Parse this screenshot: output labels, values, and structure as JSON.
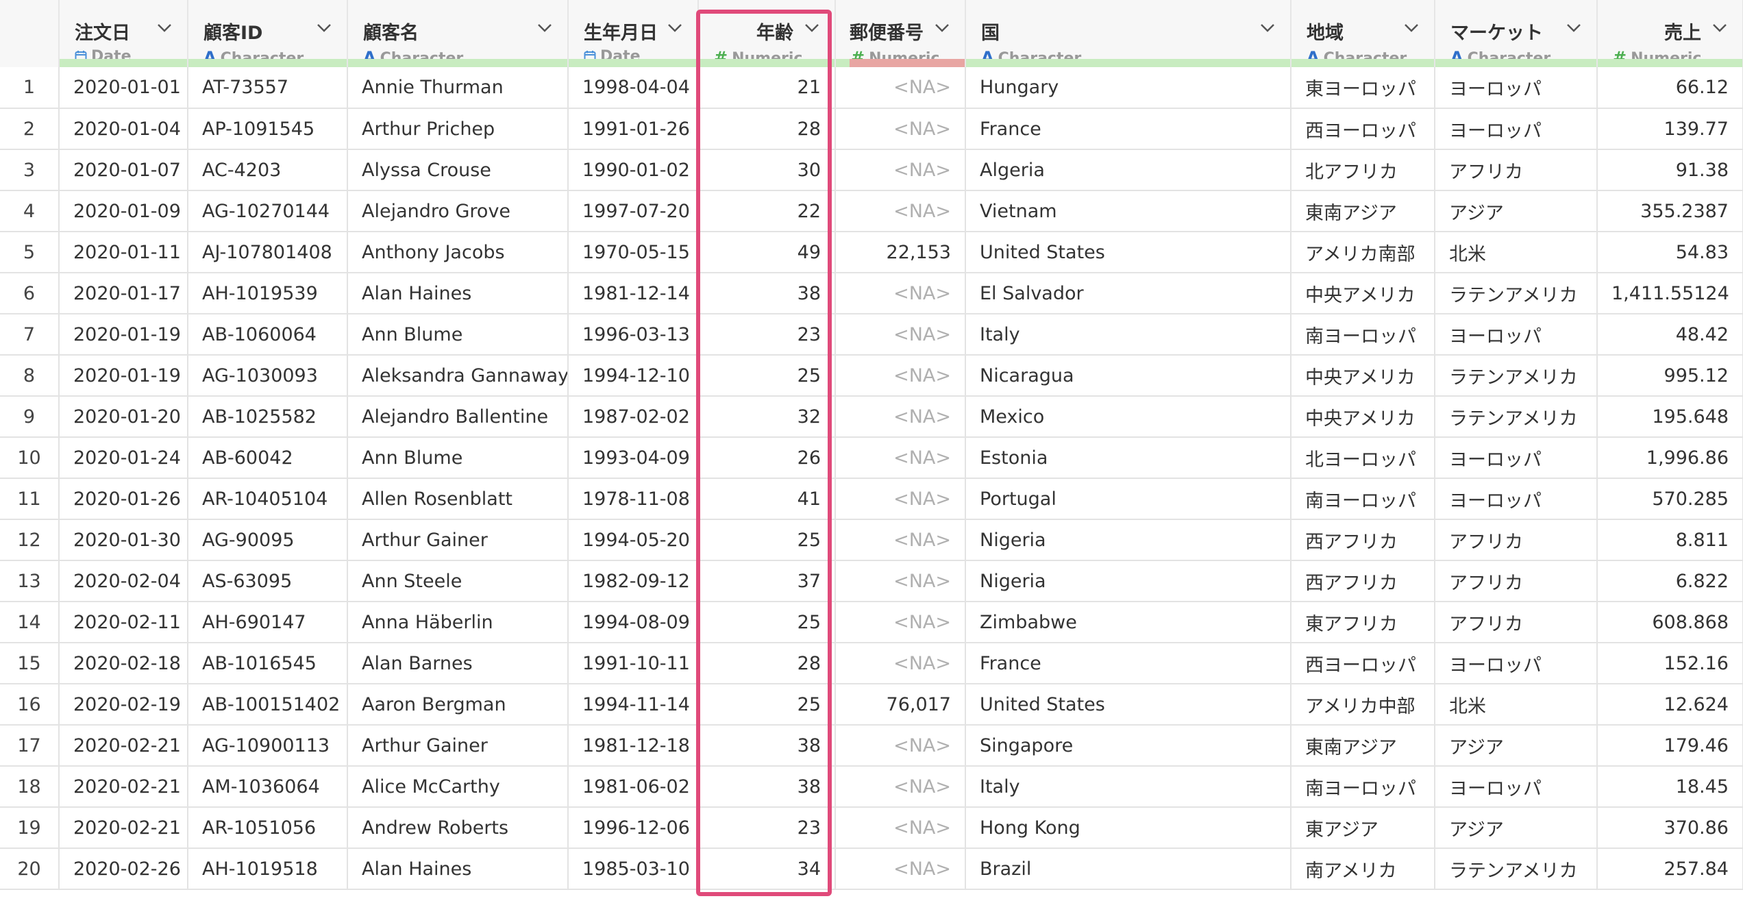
{
  "columns": [
    {
      "name": "注文日",
      "type": "Date",
      "icon": "calendar-icon",
      "align": "left",
      "bar": "green"
    },
    {
      "name": "顧客ID",
      "type": "Character",
      "icon": "character-icon",
      "align": "left",
      "bar": "green"
    },
    {
      "name": "顧客名",
      "type": "Character",
      "icon": "character-icon",
      "align": "left",
      "bar": "green"
    },
    {
      "name": "生年月日",
      "type": "Date",
      "icon": "calendar-icon",
      "align": "left",
      "bar": "green"
    },
    {
      "name": "年齢",
      "type": "Numeric",
      "icon": "hash-icon",
      "align": "right",
      "bar": "green"
    },
    {
      "name": "郵便番号",
      "type": "Numeric",
      "icon": "hash-icon",
      "align": "right",
      "bar": "mixed"
    },
    {
      "name": "国",
      "type": "Character",
      "icon": "character-icon",
      "align": "left",
      "bar": "green"
    },
    {
      "name": "地域",
      "type": "Character",
      "icon": "character-icon",
      "align": "left",
      "bar": "green"
    },
    {
      "name": "マーケット",
      "type": "Character",
      "icon": "character-icon",
      "align": "left",
      "bar": "green"
    },
    {
      "name": "売上",
      "type": "Numeric",
      "icon": "hash-icon",
      "align": "right",
      "bar": "green"
    }
  ],
  "highlighted_column": "年齢",
  "na_text": "<NA>",
  "colors": {
    "highlight": "#e04a7a",
    "bar_green": "#c8ecc0",
    "bar_red": "#e8a5a2",
    "date_icon": "#4a90d9",
    "char_icon": "#2f6fca",
    "num_icon": "#4caf50"
  },
  "rows": [
    [
      "1",
      "2020-01-01",
      "AT-73557",
      "Annie Thurman",
      "1998-04-04",
      "21",
      "<NA>",
      "Hungary",
      "東ヨーロッパ",
      "ヨーロッパ",
      "66.12"
    ],
    [
      "2",
      "2020-01-04",
      "AP-1091545",
      "Arthur Prichep",
      "1991-01-26",
      "28",
      "<NA>",
      "France",
      "西ヨーロッパ",
      "ヨーロッパ",
      "139.77"
    ],
    [
      "3",
      "2020-01-07",
      "AC-4203",
      "Alyssa Crouse",
      "1990-01-02",
      "30",
      "<NA>",
      "Algeria",
      "北アフリカ",
      "アフリカ",
      "91.38"
    ],
    [
      "4",
      "2020-01-09",
      "AG-10270144",
      "Alejandro Grove",
      "1997-07-20",
      "22",
      "<NA>",
      "Vietnam",
      "東南アジア",
      "アジア",
      "355.2387"
    ],
    [
      "5",
      "2020-01-11",
      "AJ-107801408",
      "Anthony Jacobs",
      "1970-05-15",
      "49",
      "22,153",
      "United States",
      "アメリカ南部",
      "北米",
      "54.83"
    ],
    [
      "6",
      "2020-01-17",
      "AH-1019539",
      "Alan Haines",
      "1981-12-14",
      "38",
      "<NA>",
      "El Salvador",
      "中央アメリカ",
      "ラテンアメリカ",
      "1,411.55124"
    ],
    [
      "7",
      "2020-01-19",
      "AB-1060064",
      "Ann Blume",
      "1996-03-13",
      "23",
      "<NA>",
      "Italy",
      "南ヨーロッパ",
      "ヨーロッパ",
      "48.42"
    ],
    [
      "8",
      "2020-01-19",
      "AG-1030093",
      "Aleksandra Gannaway",
      "1994-12-10",
      "25",
      "<NA>",
      "Nicaragua",
      "中央アメリカ",
      "ラテンアメリカ",
      "995.12"
    ],
    [
      "9",
      "2020-01-20",
      "AB-1025582",
      "Alejandro Ballentine",
      "1987-02-02",
      "32",
      "<NA>",
      "Mexico",
      "中央アメリカ",
      "ラテンアメリカ",
      "195.648"
    ],
    [
      "10",
      "2020-01-24",
      "AB-60042",
      "Ann Blume",
      "1993-04-09",
      "26",
      "<NA>",
      "Estonia",
      "北ヨーロッパ",
      "ヨーロッパ",
      "1,996.86"
    ],
    [
      "11",
      "2020-01-26",
      "AR-10405104",
      "Allen Rosenblatt",
      "1978-11-08",
      "41",
      "<NA>",
      "Portugal",
      "南ヨーロッパ",
      "ヨーロッパ",
      "570.285"
    ],
    [
      "12",
      "2020-01-30",
      "AG-90095",
      "Arthur Gainer",
      "1994-05-20",
      "25",
      "<NA>",
      "Nigeria",
      "西アフリカ",
      "アフリカ",
      "8.811"
    ],
    [
      "13",
      "2020-02-04",
      "AS-63095",
      "Ann Steele",
      "1982-09-12",
      "37",
      "<NA>",
      "Nigeria",
      "西アフリカ",
      "アフリカ",
      "6.822"
    ],
    [
      "14",
      "2020-02-11",
      "AH-690147",
      "Anna Häberlin",
      "1994-08-09",
      "25",
      "<NA>",
      "Zimbabwe",
      "東アフリカ",
      "アフリカ",
      "608.868"
    ],
    [
      "15",
      "2020-02-18",
      "AB-1016545",
      "Alan Barnes",
      "1991-10-11",
      "28",
      "<NA>",
      "France",
      "西ヨーロッパ",
      "ヨーロッパ",
      "152.16"
    ],
    [
      "16",
      "2020-02-19",
      "AB-100151402",
      "Aaron Bergman",
      "1994-11-14",
      "25",
      "76,017",
      "United States",
      "アメリカ中部",
      "北米",
      "12.624"
    ],
    [
      "17",
      "2020-02-21",
      "AG-10900113",
      "Arthur Gainer",
      "1981-12-18",
      "38",
      "<NA>",
      "Singapore",
      "東南アジア",
      "アジア",
      "179.46"
    ],
    [
      "18",
      "2020-02-21",
      "AM-1036064",
      "Alice McCarthy",
      "1981-06-02",
      "38",
      "<NA>",
      "Italy",
      "南ヨーロッパ",
      "ヨーロッパ",
      "18.45"
    ],
    [
      "19",
      "2020-02-21",
      "AR-1051056",
      "Andrew Roberts",
      "1996-12-06",
      "23",
      "<NA>",
      "Hong Kong",
      "東アジア",
      "アジア",
      "370.86"
    ],
    [
      "20",
      "2020-02-26",
      "AH-1019518",
      "Alan Haines",
      "1985-03-10",
      "34",
      "<NA>",
      "Brazil",
      "南アメリカ",
      "ラテンアメリカ",
      "257.84"
    ]
  ]
}
